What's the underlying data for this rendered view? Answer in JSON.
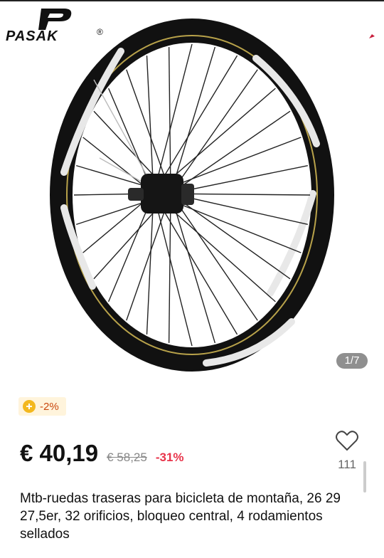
{
  "brand": {
    "name": "PASAK",
    "reg": "®"
  },
  "gallery": {
    "counter": "1/7"
  },
  "promo": {
    "coin_discount": "-2%"
  },
  "pricing": {
    "price": "€ 40,19",
    "old_price": "€ 58,25",
    "discount": "-31%"
  },
  "wishlist": {
    "count": "111"
  },
  "product": {
    "title": "Mtb-ruedas traseras para bicicleta de montaña, 26 29 27,5er, 32 orificios, bloqueo central, 4 rodamientos sellados"
  },
  "colors": {
    "price_discount": "#e8334a",
    "coin": "#f3b81e",
    "coin_bg": "#fff4dc"
  },
  "icons": [
    "brand-logo-icon",
    "coin-icon",
    "heart-icon"
  ]
}
